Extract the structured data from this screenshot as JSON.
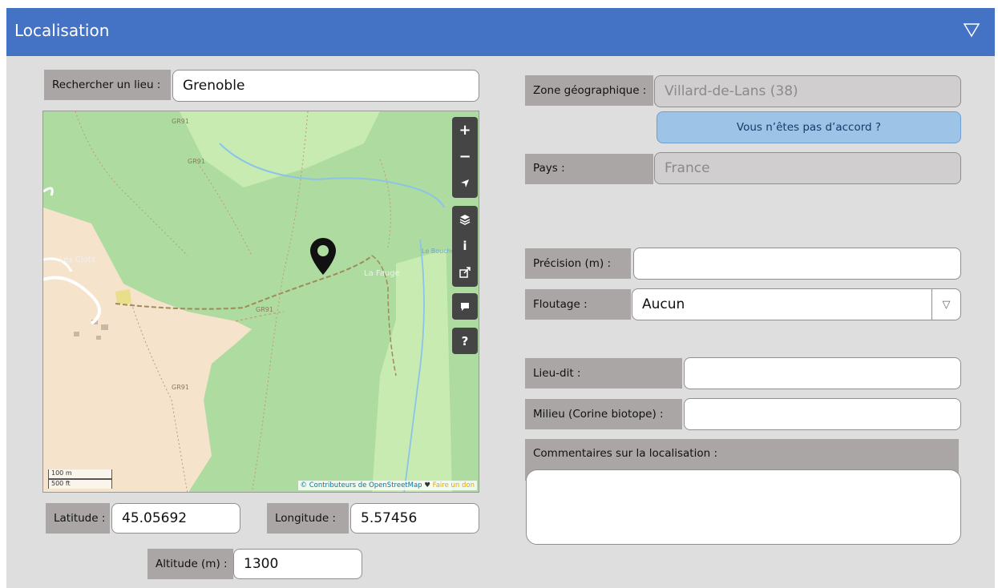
{
  "header": {
    "title": "Localisation"
  },
  "search": {
    "label": "Rechercher un lieu :",
    "value": "Grenoble"
  },
  "map": {
    "place_labels": [
      "Les Clots",
      "La Fauge"
    ],
    "road_labels": [
      "GR91",
      "GR91",
      "GR91",
      "GR91"
    ],
    "stream_label": "Le Bouchet",
    "controls": {
      "zoom_in": "+",
      "zoom_out": "−",
      "info": "i",
      "help": "?"
    },
    "scale": {
      "metric": "100 m",
      "imperial": "500 ft"
    },
    "attribution": {
      "credit": "© Contributeurs de OpenStreetMap",
      "heart": "♥",
      "donate": "Faire un don"
    }
  },
  "coords": {
    "latitude_label": "Latitude :",
    "latitude": "45.05692",
    "longitude_label": "Longitude :",
    "longitude": "5.57456",
    "altitude_label": "Altitude (m) :",
    "altitude": "1300"
  },
  "zone": {
    "label": "Zone géographique :",
    "value": "Villard-de-Lans (38)",
    "disagree_button": "Vous n’êtes pas d’accord ?"
  },
  "country": {
    "label": "Pays :",
    "value": "France"
  },
  "precision": {
    "label": "Précision (m) :",
    "value": ""
  },
  "floutage": {
    "label": "Floutage :",
    "value": "Aucun"
  },
  "lieu_dit": {
    "label": "Lieu-dit :",
    "value": ""
  },
  "milieu": {
    "label": "Milieu (Corine biotope) :",
    "value": ""
  },
  "comments": {
    "label": "Commentaires sur la localisation :",
    "value": ""
  },
  "colors": {
    "header": "#4472c4",
    "panel": "#dedede",
    "label": "#aaa6a6",
    "readonly": "#d0cece",
    "button": "#9dc3e6",
    "forest": "#aedb9f",
    "meadow": "#c8ebb2",
    "village": "#f5e3cc"
  }
}
